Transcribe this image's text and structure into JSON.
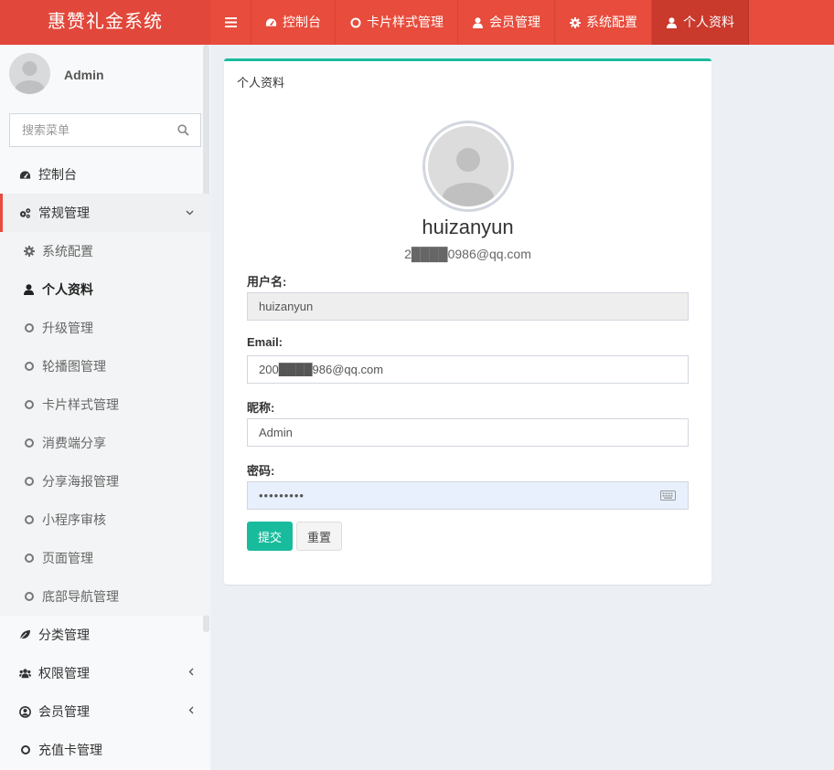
{
  "header": {
    "logo": "惠赞礼金系统",
    "nav": [
      {
        "label": "控制台",
        "icon": "dashboard-icon"
      },
      {
        "label": "卡片样式管理",
        "icon": "circle-o-icon"
      },
      {
        "label": "会员管理",
        "icon": "user-icon"
      },
      {
        "label": "系统配置",
        "icon": "gear-icon"
      },
      {
        "label": "个人资料",
        "icon": "user-icon",
        "active": true
      }
    ]
  },
  "sidebar": {
    "user_name": "Admin",
    "search_placeholder": "搜索菜单",
    "items": [
      {
        "label": "控制台",
        "icon": "dashboard-icon"
      },
      {
        "label": "常规管理",
        "icon": "cogs-icon",
        "open": true
      },
      {
        "label": "分类管理",
        "icon": "leaf-icon"
      },
      {
        "label": "权限管理",
        "icon": "group-icon"
      },
      {
        "label": "会员管理",
        "icon": "user-circle-icon"
      },
      {
        "label": "充值卡管理",
        "icon": "circle-o-icon"
      }
    ],
    "subitems": [
      {
        "label": "系统配置",
        "icon": "gear-icon"
      },
      {
        "label": "个人资料",
        "icon": "user-icon",
        "active": true
      },
      {
        "label": "升级管理",
        "icon": "circle-o-icon"
      },
      {
        "label": "轮播图管理",
        "icon": "circle-o-icon"
      },
      {
        "label": "卡片样式管理",
        "icon": "circle-o-icon"
      },
      {
        "label": "消费端分享",
        "icon": "circle-o-icon"
      },
      {
        "label": "分享海报管理",
        "icon": "circle-o-icon"
      },
      {
        "label": "小程序审核",
        "icon": "circle-o-icon"
      },
      {
        "label": "页面管理",
        "icon": "circle-o-icon"
      },
      {
        "label": "底部导航管理",
        "icon": "circle-o-icon"
      }
    ]
  },
  "panel": {
    "title": "个人资料",
    "profile_name": "huizanyun",
    "profile_email": "2████0986@qq.com",
    "labels": {
      "username": "用户名:",
      "email": "Email:",
      "nickname": "昵称:",
      "password": "密码:"
    },
    "values": {
      "username": "huizanyun",
      "email": "200████986@qq.com",
      "nickname": "Admin",
      "password": "•••••••••"
    },
    "buttons": {
      "submit": "提交",
      "reset": "重置"
    }
  },
  "colors": {
    "header": "#e74c3c",
    "accent": "#18bc9c"
  }
}
